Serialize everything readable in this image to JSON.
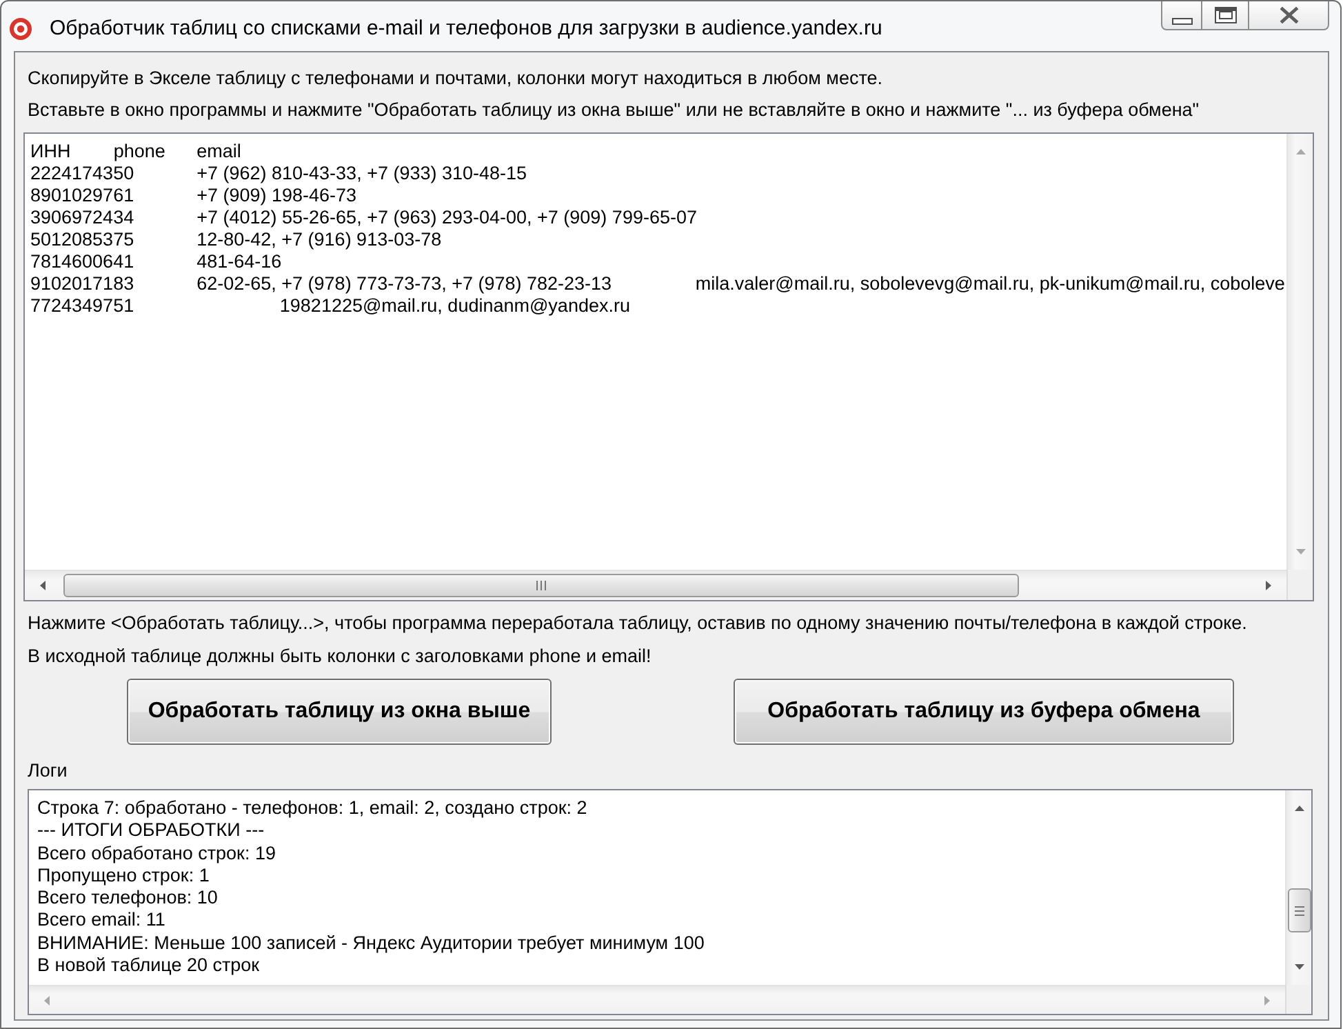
{
  "window": {
    "title": "Обработчик таблиц со списками e-mail и телефонов для загрузки в audience.yandex.ru"
  },
  "instructions": [
    "Скопируйте в Экселе таблицу с телефонами и почтами, колонки могут находиться в любом месте.",
    "Вставьте в окно программы и нажмите \"Обработать таблицу из окна выше\" или не вставляйте в окно и нажмите \"... из буфера обмена\""
  ],
  "input_table": {
    "columns": [
      "ИНН",
      "phone",
      "email"
    ],
    "rows": [
      {
        "inn": "2224174350",
        "phone": "+7 (962) 810-43-33, +7 (933) 310-48-15"
      },
      {
        "inn": "8901029761",
        "phone": "+7 (909) 198-46-73"
      },
      {
        "inn": "3906972434",
        "phone": "+7 (4012) 55-26-65, +7 (963) 293-04-00, +7 (909) 799-65-07"
      },
      {
        "inn": "5012085375",
        "phone": "12-80-42, +7 (916) 913-03-78"
      },
      {
        "inn": "7814600641",
        "phone": "481-64-16"
      },
      {
        "inn": "9102017183",
        "phone": "62-02-65, +7 (978) 773-73-73, +7 (978) 782-23-13",
        "email": "mila.valer@mail.ru, sobolevevg@mail.ru, pk-unikum@mail.ru, coboleve"
      },
      {
        "inn": "7724349751",
        "email": "19821225@mail.ru, dudinanm@yandex.ru"
      }
    ]
  },
  "notes": [
    "Нажмите <Обработать таблицу...>, чтобы программа переработала таблицу, оставив по одному значению почты/телефона в каждой строке.",
    "В исходной таблице должны быть колонки с заголовками phone и email!"
  ],
  "buttons": [
    "Обработать таблицу из окна выше",
    "Обработать таблицу из буфера обмена"
  ],
  "log": {
    "label": "Логи",
    "lines": [
      "Строка 7: обработано - телефонов: 1, email: 2, создано строк: 2",
      "--- ИТОГИ ОБРАБОТКИ ---",
      "Всего обработано строк: 19",
      "Пропущено строк: 1",
      "Всего телефонов: 10",
      "Всего email: 11",
      "ВНИМАНИЕ: Меньше 100 записей - Яндекс Аудитории требует минимум 100",
      "В новой таблице 20 строк"
    ]
  }
}
